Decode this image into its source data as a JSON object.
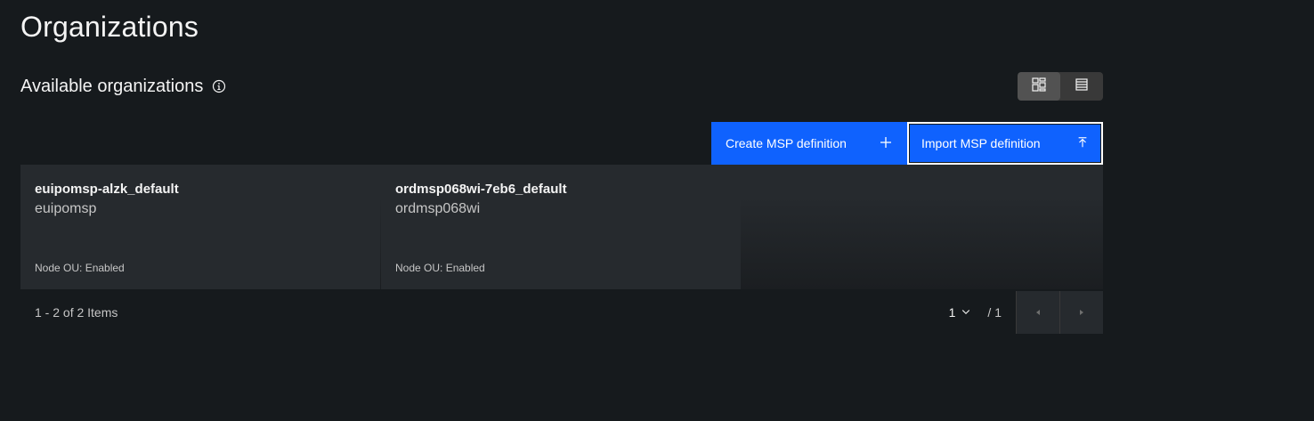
{
  "page": {
    "title": "Organizations"
  },
  "section": {
    "title": "Available organizations",
    "info_icon": "info-icon"
  },
  "view_toggle": {
    "options": [
      "tile-view-icon",
      "list-view-icon"
    ],
    "selected": "tile-view-icon"
  },
  "toolbar": {
    "create_label": "Create MSP definition",
    "create_icon": "add-icon",
    "import_label": "Import MSP definition",
    "import_icon": "upload-icon"
  },
  "organizations": [
    {
      "name": "euipomsp-alzk_default",
      "msp_id": "euipomsp",
      "node_ou": "Node OU: Enabled"
    },
    {
      "name": "ordmsp068wi-7eb6_default",
      "msp_id": "ordmsp068wi",
      "node_ou": "Node OU: Enabled"
    }
  ],
  "pagination": {
    "items_label": "1 - 2 of 2 Items",
    "current_page": "1",
    "total_pages": "/ 1"
  },
  "colors": {
    "background": "#161a1d",
    "card": "#262a2e",
    "primary_button": "#0f62fe",
    "text_primary": "#f4f4f4",
    "text_secondary": "#c6c6c6"
  }
}
